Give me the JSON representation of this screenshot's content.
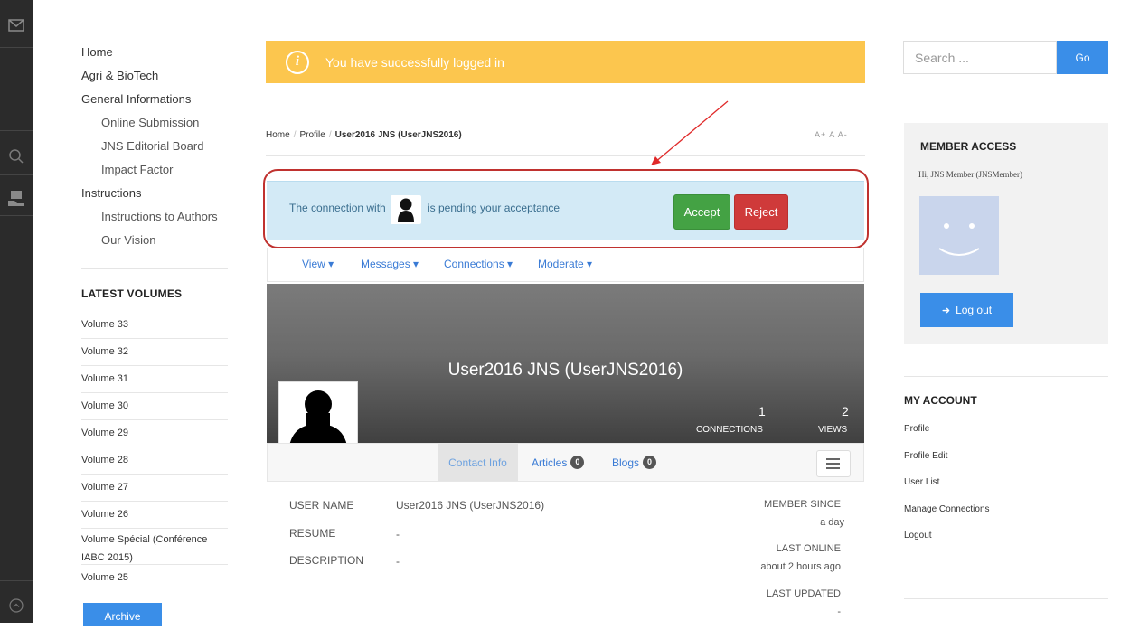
{
  "rail": {
    "icons": [
      "mail-icon",
      "search-icon",
      "book-hand-icon",
      "scroll-up-icon"
    ]
  },
  "left_nav": {
    "items": [
      {
        "label": "Home",
        "sub": false
      },
      {
        "label": "Agri & BioTech",
        "sub": false
      },
      {
        "label": "General Informations",
        "sub": false
      },
      {
        "label": "Online Submission",
        "sub": true
      },
      {
        "label": "JNS Editorial Board",
        "sub": true
      },
      {
        "label": "Impact Factor",
        "sub": true
      },
      {
        "label": "Instructions",
        "sub": false
      },
      {
        "label": "Instructions to Authors",
        "sub": true
      },
      {
        "label": "Our Vision",
        "sub": true
      }
    ],
    "latest_volumes_title": "LATEST VOLUMES",
    "volumes": [
      "Volume 33",
      "Volume 32",
      "Volume 31",
      "Volume 30",
      "Volume 29",
      "Volume 28",
      "Volume 27",
      "Volume 26",
      "Volume Spécial (Conférence IABC 2015)",
      "Volume 25"
    ],
    "archive_label": "Archive"
  },
  "alert": {
    "text": "You have successfully logged in",
    "icon": "info-icon",
    "color": "#fcc64e"
  },
  "breadcrumb": {
    "items": [
      "Home",
      "Profile"
    ],
    "current": "User2016 JNS (UserJNS2016)",
    "font_controls": "A+ A A-"
  },
  "pending": {
    "text_before": "The connection with",
    "text_after": "is pending your acceptance",
    "accept_label": "Accept",
    "reject_label": "Reject"
  },
  "profile_menu": {
    "items": [
      "View ▾",
      "Messages ▾",
      "Connections ▾",
      "Moderate ▾"
    ]
  },
  "profile": {
    "name": "User2016 JNS (UserJNS2016)",
    "connections_count": "1",
    "connections_label": "CONNECTIONS",
    "views_count": "2",
    "views_label": "VIEWS"
  },
  "profile_tabs": {
    "contact": "Contact Info",
    "articles": "Articles",
    "articles_count": "0",
    "blogs": "Blogs",
    "blogs_count": "0"
  },
  "details": {
    "user_name_label": "USER NAME",
    "user_name_value": "User2016 JNS (UserJNS2016)",
    "resume_label": "RESUME",
    "resume_value": "-",
    "description_label": "DESCRIPTION",
    "description_value": "-",
    "member_since_label": "MEMBER SINCE",
    "member_since_value": "a day",
    "last_online_label": "LAST ONLINE",
    "last_online_value": "about 2 hours ago",
    "last_updated_label": "LAST UPDATED",
    "last_updated_value": "-"
  },
  "sidebar": {
    "search_placeholder": "Search ...",
    "go_label": "Go",
    "member_title": "MEMBER ACCESS",
    "greeting": "Hi, JNS Member (JNSMember)",
    "logout_label": "Log out",
    "my_account_title": "MY ACCOUNT",
    "account_links": [
      "Profile",
      "Profile Edit",
      "User List",
      "Manage Connections",
      "Logout"
    ]
  }
}
